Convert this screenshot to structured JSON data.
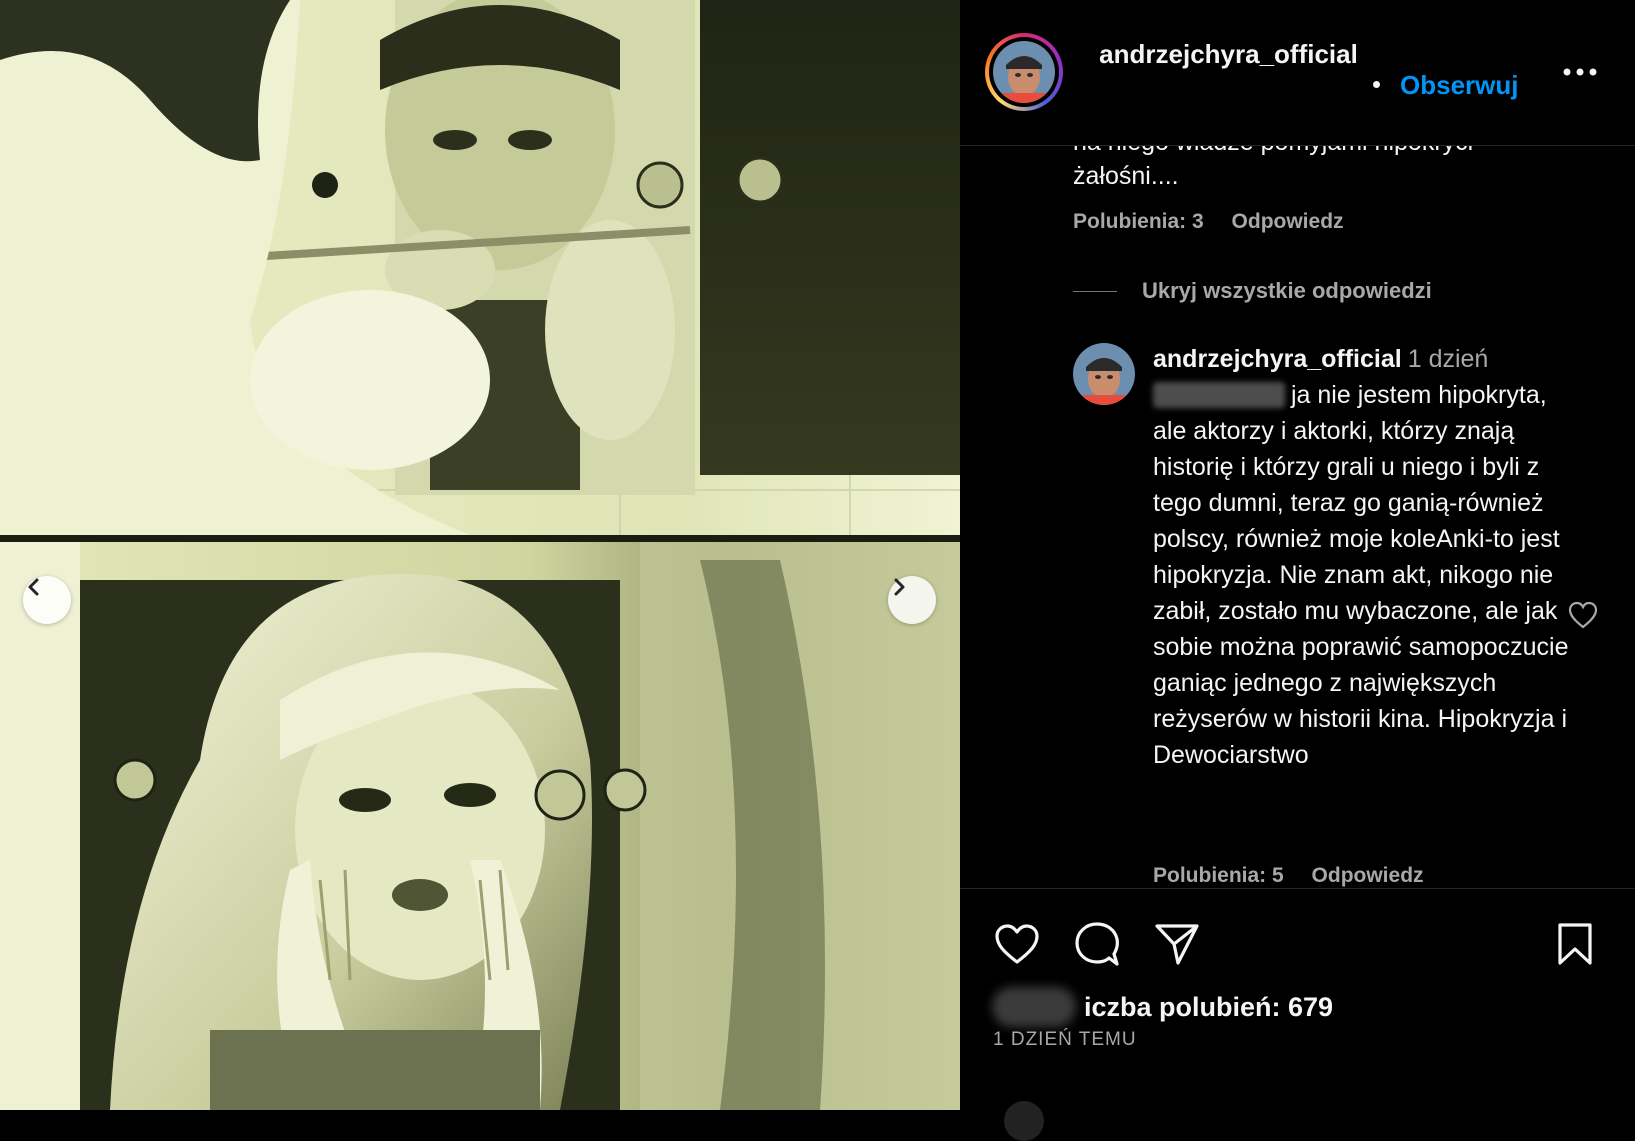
{
  "post": {
    "username": "andrzejchyra_official",
    "follow_label": "Obserwuj"
  },
  "icons": {
    "prev": "chevron-left-icon",
    "next": "chevron-right-icon",
    "more": "more-horizontal-icon",
    "like": "heart-icon",
    "comment": "comment-icon",
    "share": "send-icon",
    "save": "bookmark-icon"
  },
  "comments": {
    "first": {
      "clipped_text": "na niego władze pomyjami hipokryci",
      "text": "żałośni....",
      "likes": "Polubienia: 3",
      "reply_label": "Odpowiedz"
    },
    "hide_replies": "Ukryj wszystkie odpowiedzi",
    "reply": {
      "username": "andrzejchyra_official",
      "time": "1 dzień",
      "text": "ja nie jestem hipokryta, ale aktorzy i aktorki, którzy znają historię i którzy grali u niego i byli z tego dumni, teraz go ganią-również polscy, również moje koleAnki-to jest hipokryzja. Nie znam akt, nikogo nie zabił, zostało mu wybaczone, ale jak sobie można poprawić samopoczucie ganiąc jednego z największych reżyserów w historii kina. Hipokryzja i Dewociarstwo",
      "likes": "Polubienia: 5",
      "reply_label": "Odpowiedz"
    }
  },
  "footer": {
    "likes_text": "iczba polubień: 679",
    "date": "1 DZIEŃ TEMU"
  },
  "colors": {
    "background": "#000000",
    "link_blue": "#0095f6",
    "secondary_text": "#a8a8a8",
    "photo_tint": "#ecefc9"
  }
}
